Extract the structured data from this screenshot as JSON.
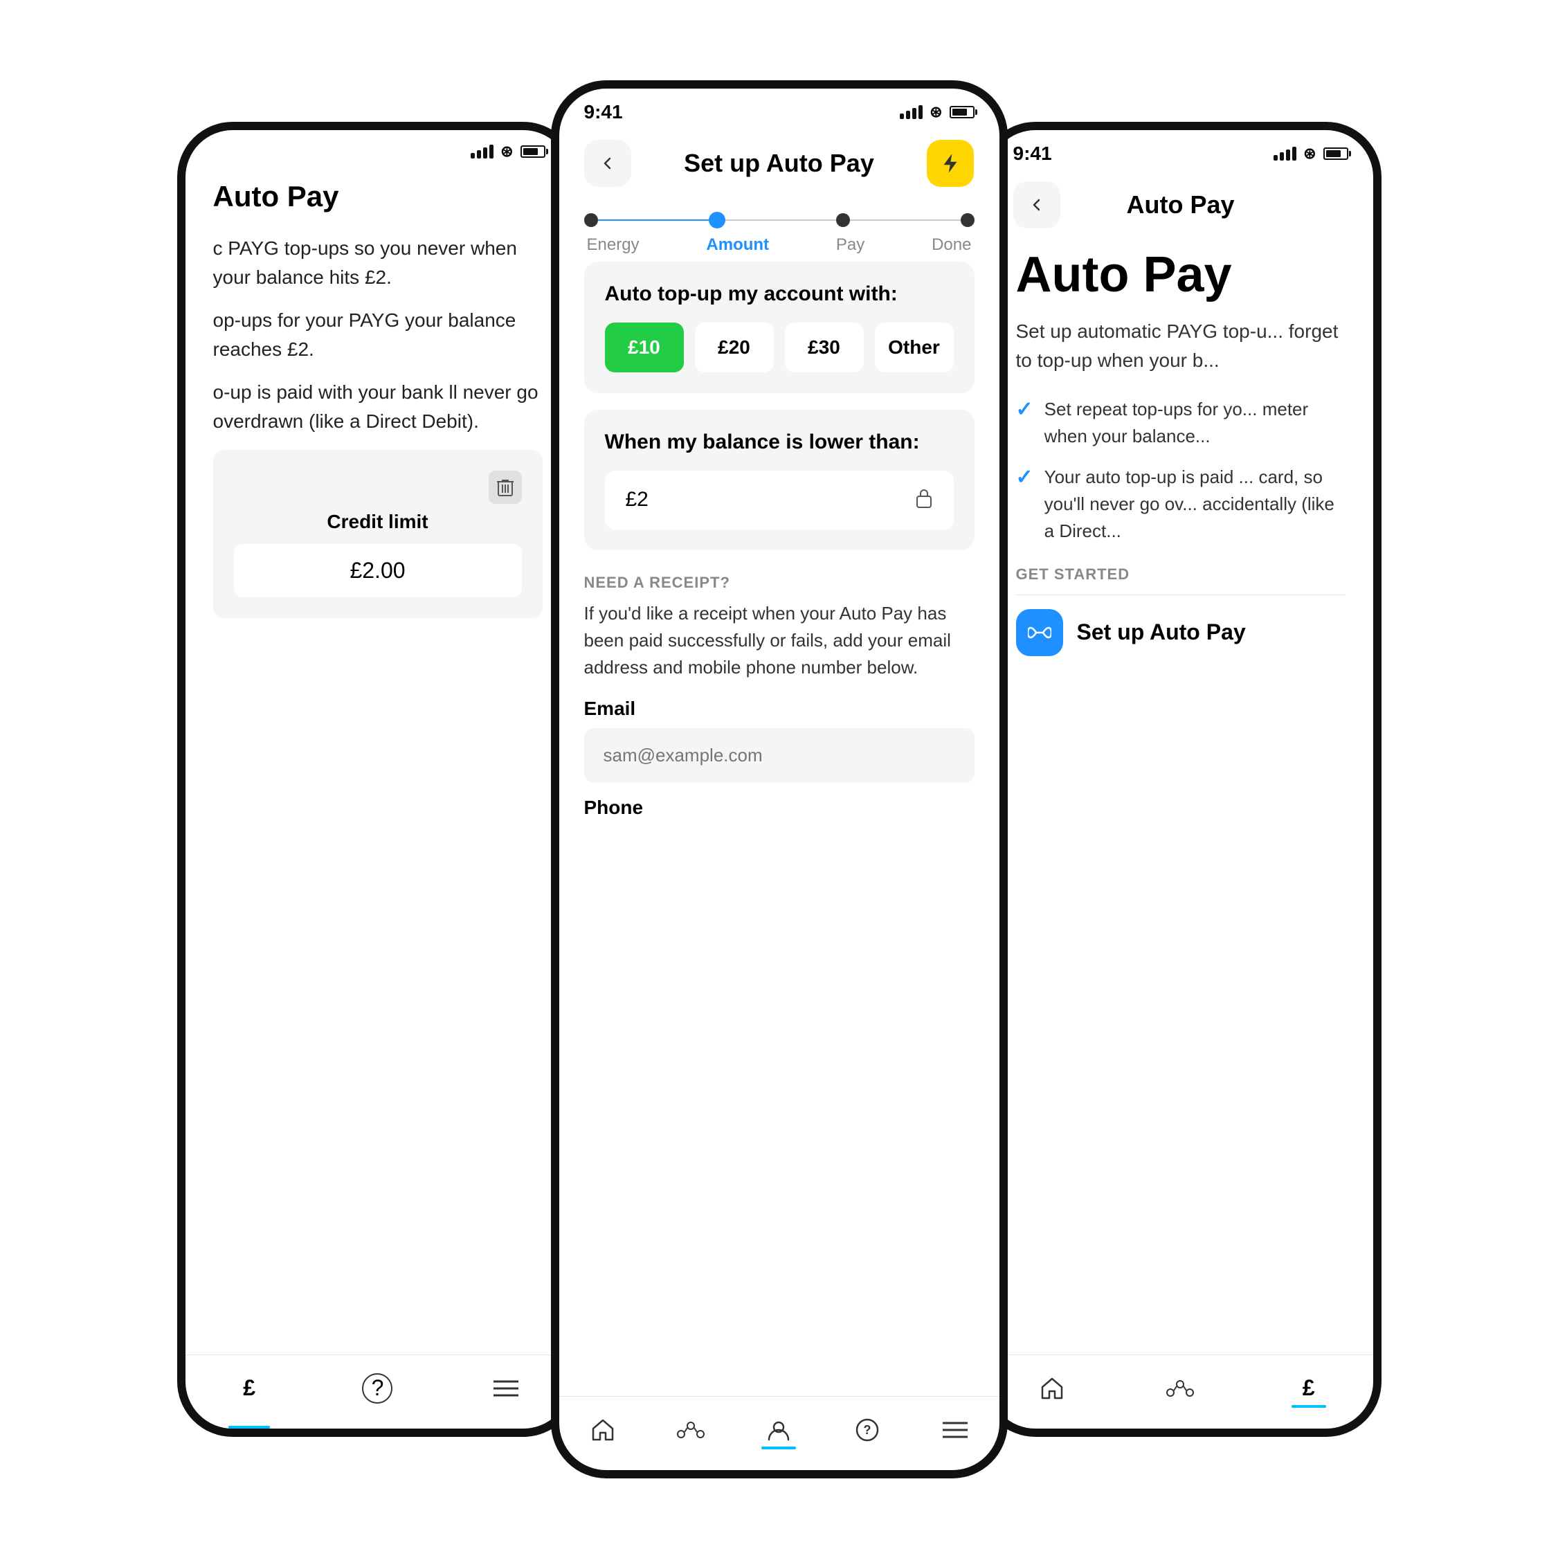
{
  "scene": {
    "background": "#ffffff"
  },
  "left_phone": {
    "status_bar": {
      "time": "",
      "signal": true,
      "wifi": true,
      "battery": true
    },
    "header": {
      "title": "Auto Pay"
    },
    "body_text_1": "c PAYG top-ups so you never when your balance hits £2.",
    "body_text_2": "op-ups for your PAYG your balance reaches £2.",
    "body_text_3": "o-up is paid with your bank ll never go overdrawn (like a Direct Debit).",
    "credit_limit": {
      "label": "Credit limit",
      "value": "£2.00"
    },
    "nav": {
      "items": [
        "£",
        "?",
        "≡"
      ]
    }
  },
  "center_phone": {
    "status_bar": {
      "time": "9:41"
    },
    "header": {
      "back_label": "←",
      "title": "Set up Auto Pay",
      "action_icon": "⚡"
    },
    "progress": {
      "steps": [
        "Energy",
        "Amount",
        "Pay",
        "Done"
      ],
      "active_index": 1
    },
    "top_up_section": {
      "title": "Auto top-up my account with:",
      "options": [
        "£10",
        "£20",
        "£30",
        "Other"
      ],
      "selected_index": 0
    },
    "balance_section": {
      "title": "When my balance is lower than:",
      "value": "£2"
    },
    "receipt_section": {
      "label": "NEED A RECEIPT?",
      "description": "If you'd like a receipt when your Auto Pay has been paid successfully or fails, add your email address and mobile phone number below.",
      "email_label": "Email",
      "email_placeholder": "sam@example.com",
      "phone_label": "Phone"
    },
    "nav": {
      "items": [
        "home",
        "network",
        "account",
        "help",
        "menu"
      ]
    }
  },
  "right_phone": {
    "status_bar": {
      "time": "9:41"
    },
    "header": {
      "back_label": "←",
      "title": "Auto Pay"
    },
    "main_title": "Auto Pay",
    "description": "Set up automatic PAYG top-u... forget to top-up when your b...",
    "checklist": [
      "Set repeat top-ups for yo... meter when your balance...",
      "Your auto top-up is paid ... card, so you'll never go ov... accidentally (like a Direct..."
    ],
    "get_started": {
      "label": "GET STARTED",
      "button_icon": "∞",
      "button_text": "Set up Auto Pay"
    },
    "nav": {
      "items": [
        "home",
        "network",
        "account"
      ]
    }
  }
}
